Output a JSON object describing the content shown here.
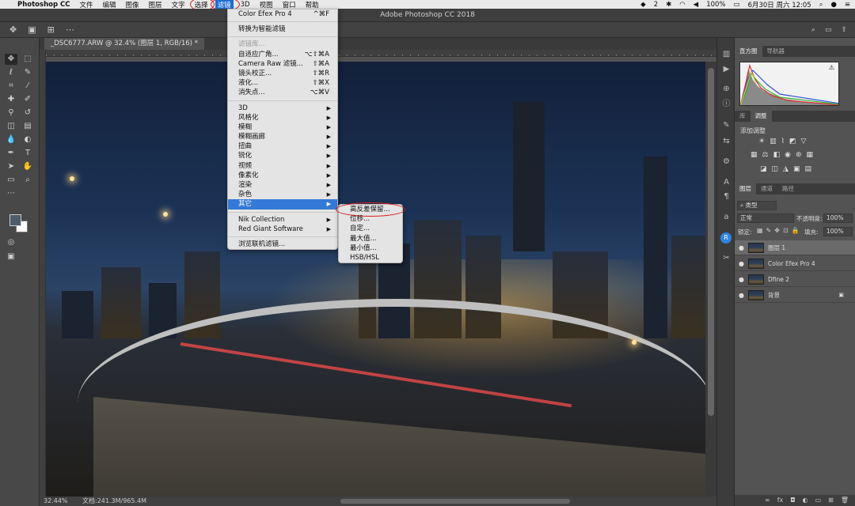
{
  "menubar": {
    "app": "Photoshop CC",
    "items": [
      "文件",
      "编辑",
      "图像",
      "图层",
      "文字",
      "选择",
      "滤镜",
      "3D",
      "视图",
      "窗口",
      "帮助"
    ],
    "right": {
      "notif": "2",
      "battery": "100%",
      "datetime": "6月30日 周六  12:05"
    }
  },
  "window": {
    "title": "Adobe Photoshop CC 2018"
  },
  "document": {
    "tab": "_DSC6777.ARW @ 32.4% (图层 1, RGB/16) *",
    "zoom": "32.44%",
    "doc_size": "文档:241.3M/965.4M"
  },
  "filter_menu": {
    "items": [
      {
        "label": "Color Efex Pro 4",
        "shortcut": "^⌘F"
      },
      {
        "sep": true
      },
      {
        "label": "转换为智能滤镜"
      },
      {
        "sep": true
      },
      {
        "label": "滤镜库...",
        "disabled": true
      },
      {
        "label": "自适应广角...",
        "shortcut": "⌥⇧⌘A"
      },
      {
        "label": "Camera Raw 滤镜...",
        "shortcut": "⇧⌘A"
      },
      {
        "label": "镜头校正...",
        "shortcut": "⇧⌘R"
      },
      {
        "label": "液化...",
        "shortcut": "⇧⌘X"
      },
      {
        "label": "消失点...",
        "shortcut": "⌥⌘V"
      },
      {
        "sep": true
      },
      {
        "label": "3D",
        "submenu": true
      },
      {
        "label": "风格化",
        "submenu": true
      },
      {
        "label": "模糊",
        "submenu": true
      },
      {
        "label": "模糊画廊",
        "submenu": true
      },
      {
        "label": "扭曲",
        "submenu": true
      },
      {
        "label": "锐化",
        "submenu": true
      },
      {
        "label": "视频",
        "submenu": true
      },
      {
        "label": "像素化",
        "submenu": true
      },
      {
        "label": "渲染",
        "submenu": true
      },
      {
        "label": "杂色",
        "submenu": true
      },
      {
        "label": "其它",
        "submenu": true,
        "highlighted": true
      },
      {
        "sep": true
      },
      {
        "label": "Nik Collection",
        "submenu": true
      },
      {
        "label": "Red Giant Software",
        "submenu": true
      },
      {
        "sep": true
      },
      {
        "label": "浏览联机滤镜..."
      }
    ]
  },
  "other_submenu": {
    "items": [
      "高反差保留...",
      "位移...",
      "自定...",
      "最大值...",
      "最小值...",
      "HSB/HSL"
    ]
  },
  "panels": {
    "histogram_tabs": [
      "直方图",
      "导航器"
    ],
    "adjust_tabs": [
      "库",
      "调整"
    ],
    "adjust_title": "添加调整",
    "layers_tabs": [
      "图层",
      "通道",
      "路径"
    ],
    "filter_kind": "类型",
    "blend_mode": "正常",
    "opacity_label": "不透明度:",
    "opacity": "100%",
    "lock_label": "锁定:",
    "fill_label": "填充:",
    "fill": "100%",
    "layers": [
      {
        "name": "图层 1",
        "selected": true
      },
      {
        "name": "Color Efex Pro 4"
      },
      {
        "name": "Dfine 2"
      },
      {
        "name": "背景",
        "locked": true
      }
    ]
  },
  "colors": {
    "accent": "#3479d6",
    "annotation": "#d82020"
  },
  "icons": {
    "lock": "🔒",
    "eye": "👁",
    "apple": "",
    "gear": "⚙"
  }
}
